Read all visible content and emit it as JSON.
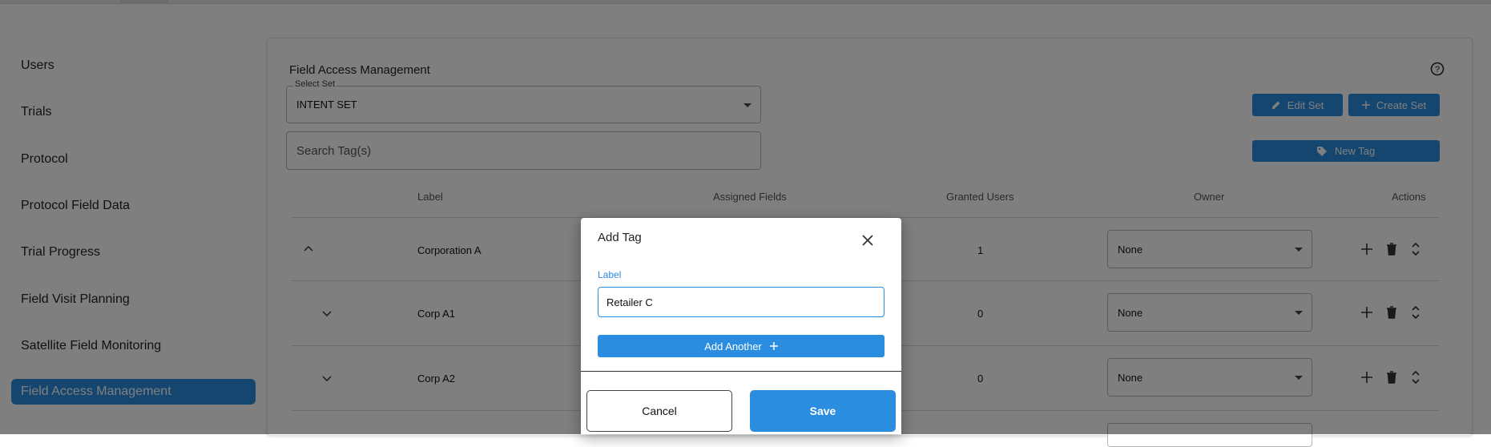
{
  "sidebar": {
    "items": [
      {
        "label": "Users"
      },
      {
        "label": "Trials"
      },
      {
        "label": "Protocol"
      },
      {
        "label": "Protocol Field Data"
      },
      {
        "label": "Trial Progress"
      },
      {
        "label": "Field Visit Planning"
      },
      {
        "label": "Satellite Field Monitoring"
      },
      {
        "label": "Field Access Management"
      }
    ],
    "active": "Field Access Management"
  },
  "main": {
    "title": "Field Access Management",
    "select_set": {
      "legend": "Select Set",
      "value": "INTENT SET"
    },
    "search": {
      "placeholder": "Search Tag(s)"
    },
    "buttons": {
      "edit_set": "Edit Set",
      "create_set": "Create Set",
      "new_tag": "New Tag"
    },
    "table": {
      "headers": {
        "label": "Label",
        "assigned_fields": "Assigned Fields",
        "granted_users": "Granted Users",
        "owner": "Owner",
        "actions": "Actions"
      },
      "rows": [
        {
          "label": "Corporation A",
          "granted_users": "1",
          "owner": "None",
          "expand": "up"
        },
        {
          "label": "Corp A1",
          "granted_users": "0",
          "owner": "None",
          "expand": "down"
        },
        {
          "label": "Corp A2",
          "granted_users": "0",
          "owner": "None",
          "expand": "down"
        }
      ]
    }
  },
  "modal": {
    "title": "Add Tag",
    "field_label": "Label",
    "field_value": "Retailer C",
    "add_another": "Add Another",
    "cancel": "Cancel",
    "save": "Save"
  },
  "colors": {
    "accent": "#2a8de0",
    "overlay": "rgba(0,0,0,0.5)"
  }
}
